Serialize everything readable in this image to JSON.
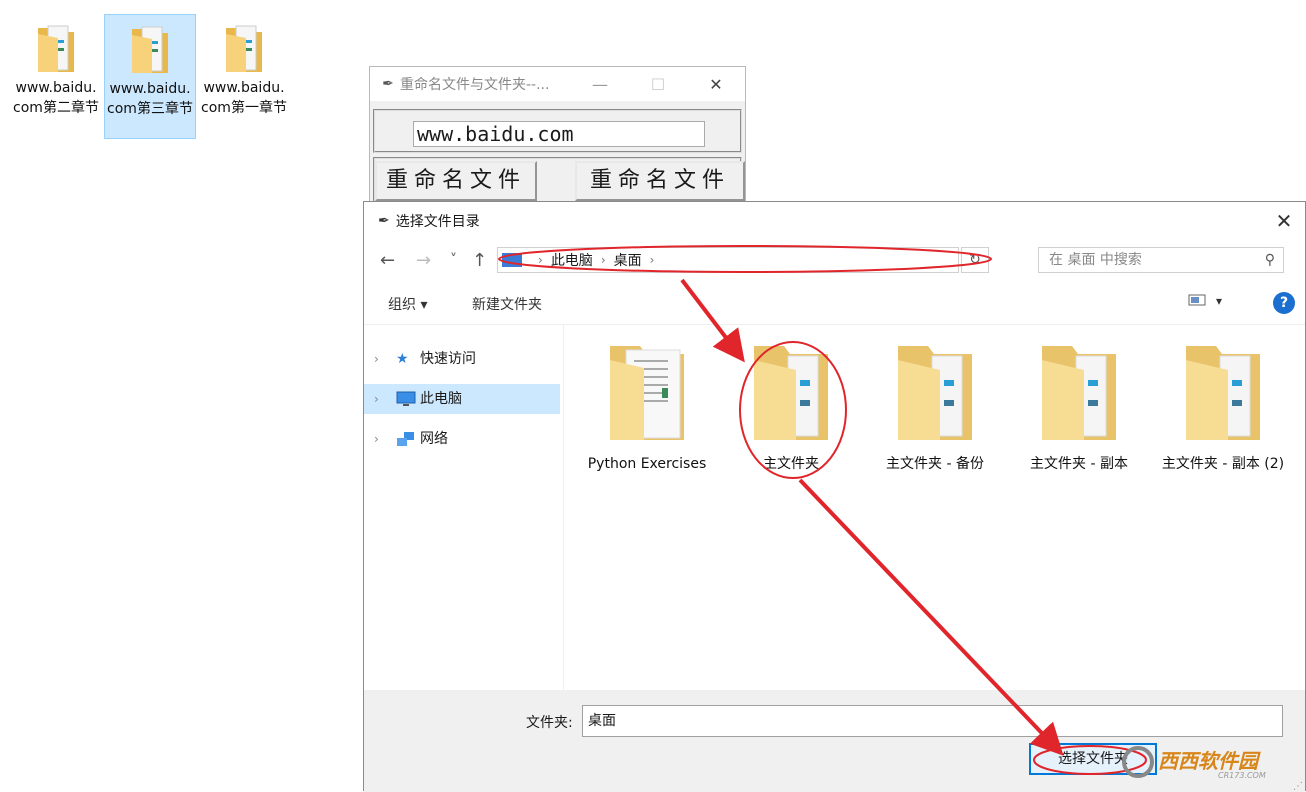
{
  "desktop": {
    "icons": [
      {
        "label": "www.baidu.com第二章节"
      },
      {
        "label": "www.baidu.com第三章节"
      },
      {
        "label": "www.baidu.com第一章节"
      }
    ]
  },
  "rename_window": {
    "title": "重命名文件与文件夹--...",
    "minimize": "—",
    "maximize": "☐",
    "close": "✕",
    "entry_value": "www.baidu.com",
    "rename_file_label": "重命名文件",
    "rename_folder_label": "重命名文件夹"
  },
  "dialog": {
    "title": "选择文件目录",
    "close": "✕",
    "nav": {
      "back": "←",
      "forward": "→",
      "recent": "˅",
      "up": "↑"
    },
    "address": {
      "crumbs": [
        "此电脑",
        "桌面"
      ]
    },
    "refresh": "↻",
    "search_placeholder": "在 桌面 中搜索",
    "toolbar": {
      "organize": "组织 ▾",
      "new_folder": "新建文件夹",
      "view": "▾",
      "help": "?"
    },
    "nav_pane": [
      {
        "label": "快速访问"
      },
      {
        "label": "此电脑"
      },
      {
        "label": "网络"
      }
    ],
    "files": [
      {
        "name": "Python Exercises"
      },
      {
        "name": "主文件夹"
      },
      {
        "name": "主文件夹 - 备份"
      },
      {
        "name": "主文件夹 - 副本"
      },
      {
        "name": "主文件夹 - 副本 (2)"
      }
    ],
    "folder_label": "文件夹:",
    "folder_value": "桌面",
    "select_button": "选择文件夹"
  },
  "watermark": {
    "text": "西西软件园",
    "sub": "CR173.COM"
  },
  "colors": {
    "annotation": "#e0252b",
    "selection": "#cce8ff",
    "accent": "#0078d7"
  }
}
